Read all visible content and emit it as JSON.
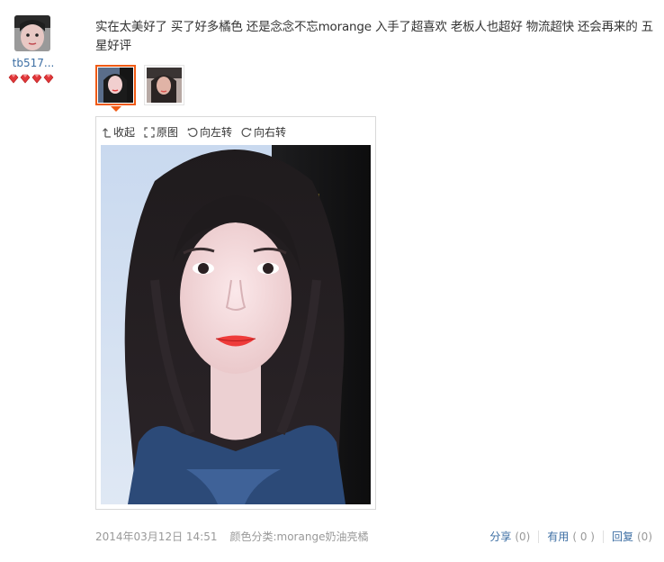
{
  "reviewer": {
    "avatar_icon": "user-avatar-photo",
    "name": "tb517...",
    "rank_icon": "red-gem-icon",
    "rank_count": 4
  },
  "review": {
    "text": "实在太美好了 买了好多橘色 还是念念不忘morange 入手了超喜欢 老板人也超好 物流超快 还会再来的 五星好评"
  },
  "thumbnails": [
    {
      "id": "photo-1",
      "selected": true
    },
    {
      "id": "photo-2",
      "selected": false
    }
  ],
  "viewer": {
    "toolbar": {
      "collapse_label": "收起",
      "original_label": "原图",
      "rotate_left_label": "向左转",
      "rotate_right_label": "向右转"
    }
  },
  "meta": {
    "date": "2014年03月12日 14:51",
    "sku": "颜色分类:morange奶油亮橘"
  },
  "actions": {
    "share_label": "分享",
    "share_count": "(0)",
    "useful_label": "有用",
    "useful_count": "( 0 )",
    "reply_label": "回复",
    "reply_count": "(0)"
  },
  "colors": {
    "link": "#3c6ea3",
    "accent": "#f05a14",
    "muted": "#999999"
  }
}
